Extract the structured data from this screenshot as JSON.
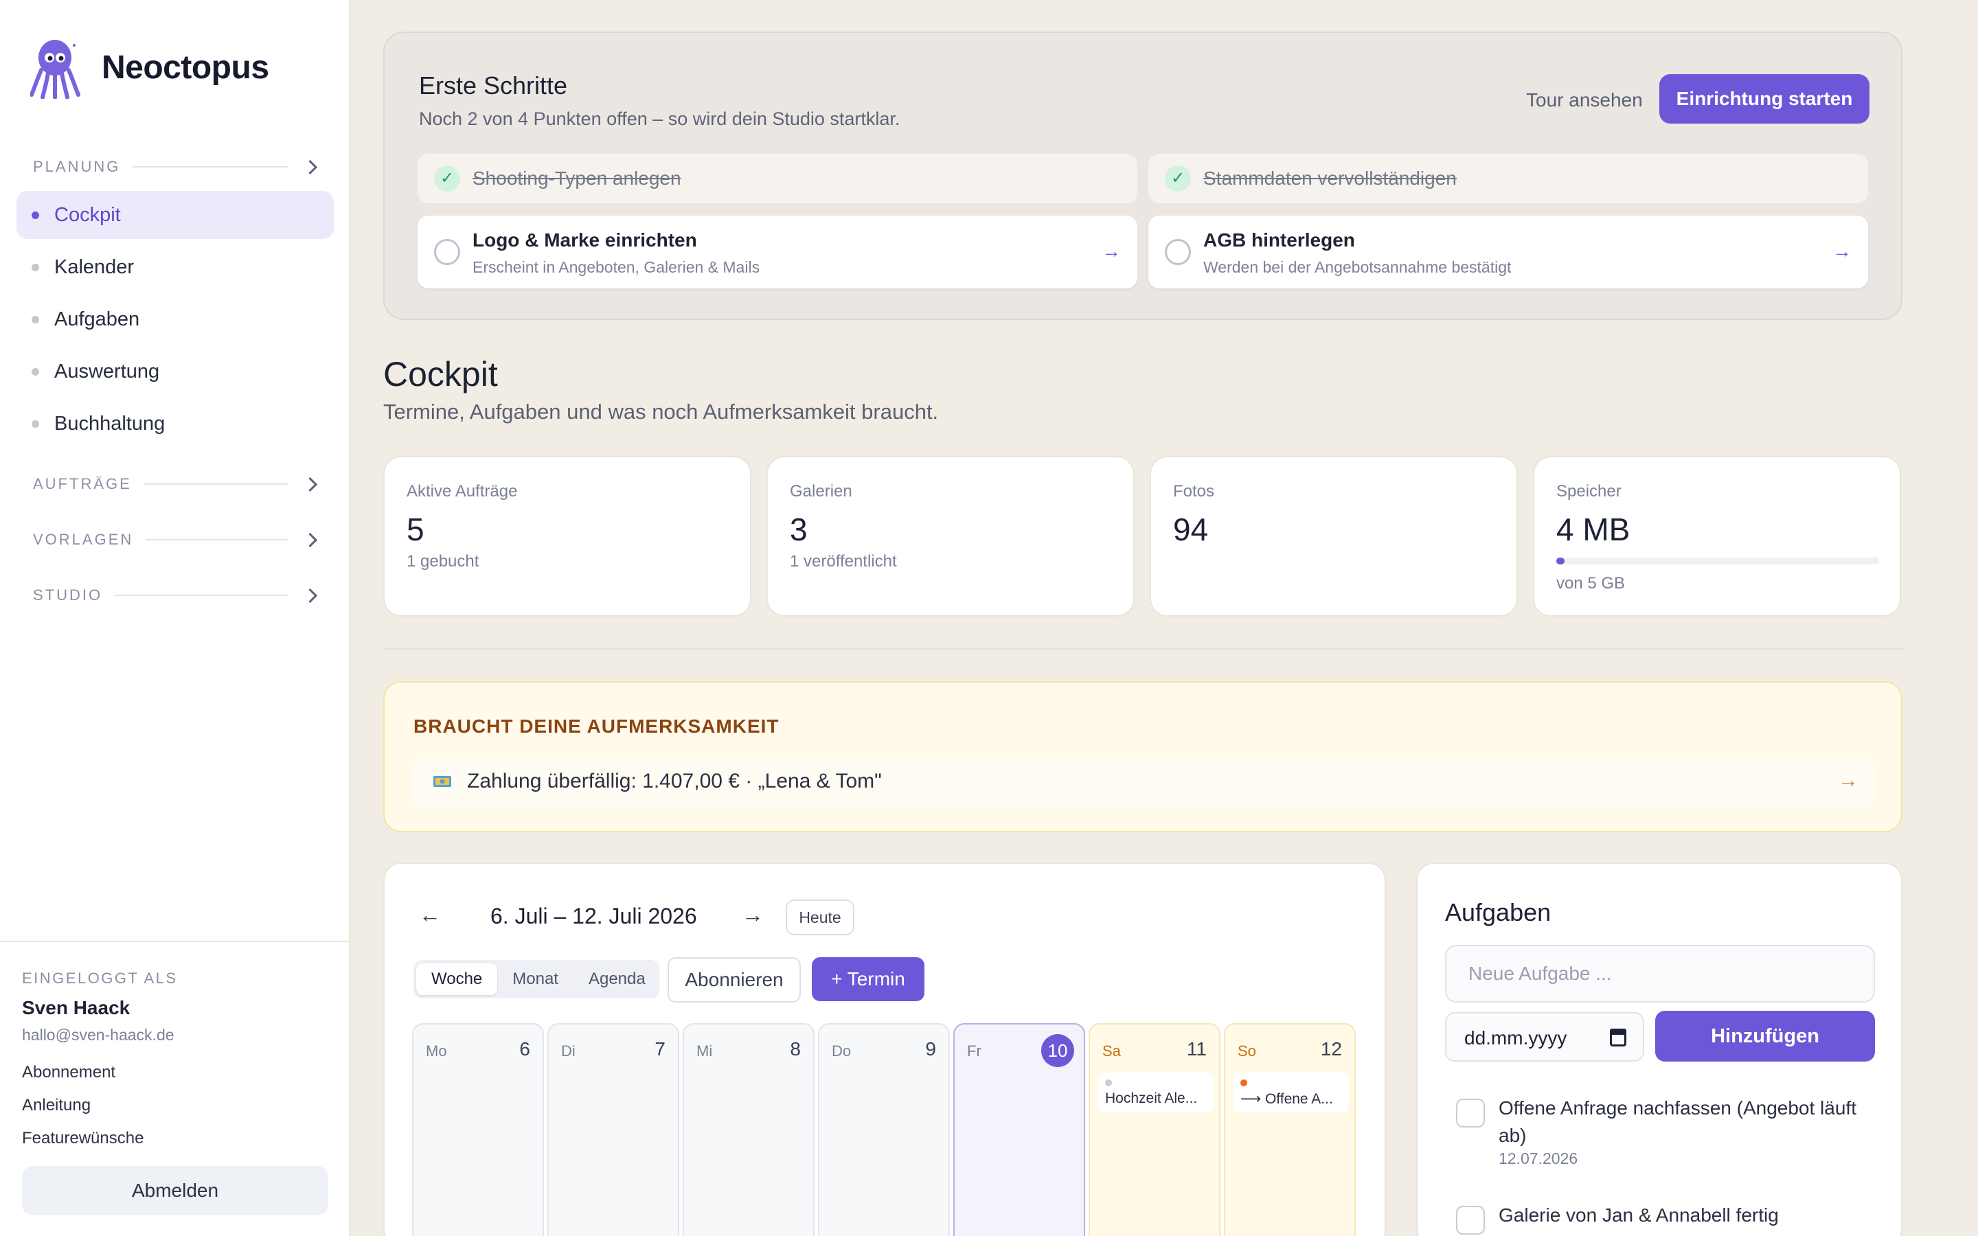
{
  "brand": {
    "name": "Neoctopus"
  },
  "sidebar": {
    "sections": [
      {
        "label": "PLANUNG"
      },
      {
        "label": "AUFTRÄGE"
      },
      {
        "label": "VORLAGEN"
      },
      {
        "label": "STUDIO"
      }
    ],
    "items": [
      {
        "label": "Cockpit",
        "active": true
      },
      {
        "label": "Kalender"
      },
      {
        "label": "Aufgaben"
      },
      {
        "label": "Auswertung"
      },
      {
        "label": "Buchhaltung"
      }
    ],
    "footer": {
      "caption": "EINGELOGGT ALS",
      "name": "Sven Haack",
      "email": "hallo@sven-haack.de",
      "links": [
        "Abonnement",
        "Anleitung",
        "Featurewünsche"
      ],
      "logout": "Abmelden"
    }
  },
  "onboarding": {
    "title": "Erste Schritte",
    "subtitle": "Noch 2 von 4 Punkten offen – so wird dein Studio startklar.",
    "tour_label": "Tour ansehen",
    "start_label": "Einrichtung starten",
    "steps": [
      {
        "title": "Shooting-Typen anlegen",
        "done": true,
        "check": "✓"
      },
      {
        "title": "Stammdaten vervollständigen",
        "done": true,
        "check": "✓"
      },
      {
        "title": "Logo & Marke einrichten",
        "desc": "Erscheint in Angeboten, Galerien & Mails",
        "done": false,
        "arrow": "→"
      },
      {
        "title": "AGB hinterlegen",
        "desc": "Werden bei der Angebotsannahme bestätigt",
        "done": false,
        "arrow": "→"
      }
    ]
  },
  "page": {
    "title": "Cockpit",
    "subtitle": "Termine, Aufgaben und was noch Aufmerksamkeit braucht."
  },
  "stats": [
    {
      "label": "Aktive Aufträge",
      "value": "5",
      "note": "1 gebucht"
    },
    {
      "label": "Galerien",
      "value": "3",
      "note": "1 veröffentlicht"
    },
    {
      "label": "Fotos",
      "value": "94"
    },
    {
      "label": "Speicher",
      "value": "4 MB",
      "note": "von 5 GB",
      "progress": 0.001
    }
  ],
  "attention": {
    "title": "BRAUCHT DEINE AUFMERKSAMKEIT",
    "item": "Zahlung überfällig: 1.407,00 € · „Lena & Tom\"",
    "arrow": "→"
  },
  "calendar": {
    "prev": "←",
    "next": "→",
    "range": "6. Juli – 12. Juli 2026",
    "today_label": "Heute",
    "views": [
      "Woche",
      "Monat",
      "Agenda"
    ],
    "active_view": "Woche",
    "subscribe_label": "Abonnieren",
    "add_label": "+ Termin",
    "days": [
      {
        "name": "Mo",
        "num": "6"
      },
      {
        "name": "Di",
        "num": "7"
      },
      {
        "name": "Mi",
        "num": "8"
      },
      {
        "name": "Do",
        "num": "9"
      },
      {
        "name": "Fr",
        "num": "10",
        "today": true
      },
      {
        "name": "Sa",
        "num": "11",
        "weekend": true,
        "event": "Hochzeit Ale...",
        "event_color": "#c9ccd8"
      },
      {
        "name": "So",
        "num": "12",
        "weekend": true,
        "event": "⟶ Offene A...",
        "event_color": "#f06a12"
      }
    ]
  },
  "tasks": {
    "title": "Aufgaben",
    "input_placeholder": "Neue Aufgabe ...",
    "date_placeholder": "dd.mm.yyyy",
    "add_label": "Hinzufügen",
    "items": [
      {
        "text": "Offene Anfrage nachfassen (Angebot läuft ab)",
        "date": "12.07.2026"
      },
      {
        "text": "Galerie von Jan & Annabell fertig"
      }
    ]
  },
  "colors": {
    "accent": "#6e56d8",
    "background": "#f2ede4",
    "warning": "#8a4412"
  }
}
